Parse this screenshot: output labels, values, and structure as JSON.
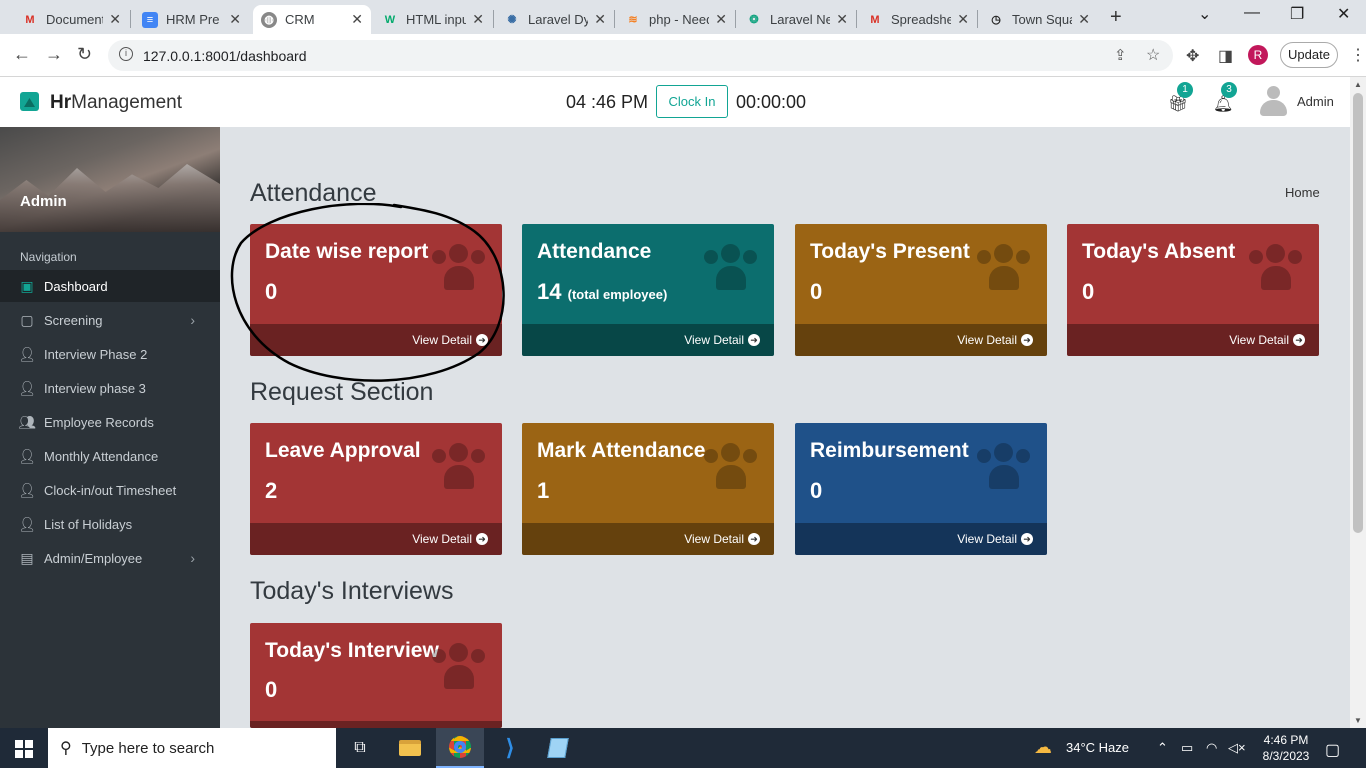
{
  "browser": {
    "tabs": [
      {
        "title": "Documents",
        "icon": "gmail-icon"
      },
      {
        "title": "HRM Pre D",
        "icon": "docs-icon"
      },
      {
        "title": "CRM",
        "icon": "globe-icon",
        "active": true
      },
      {
        "title": "HTML input",
        "icon": "w3-icon"
      },
      {
        "title": "Laravel Dy",
        "icon": "gear-icon"
      },
      {
        "title": "php - Need",
        "icon": "stackoverflow-icon"
      },
      {
        "title": "Laravel Ne",
        "icon": "openai-icon"
      },
      {
        "title": "Spreadshe",
        "icon": "gmail-icon"
      },
      {
        "title": "Town Squa",
        "icon": "clock-icon"
      }
    ],
    "url": "127.0.0.1:8001/dashboard",
    "profile_initial": "R",
    "update_label": "Update"
  },
  "header": {
    "brand_bold": "Hr",
    "brand_rest": "Management",
    "time": "04 :46 PM",
    "clock_in_label": "Clock In",
    "timer": "00:00:00",
    "gift_badge": "1",
    "bell_badge": "3",
    "user": "Admin"
  },
  "sidebar": {
    "user": "Admin",
    "heading": "Navigation",
    "items": [
      {
        "label": "Dashboard",
        "icon": "dashboard-icon",
        "active": true
      },
      {
        "label": "Screening",
        "icon": "screen-icon",
        "submenu": true
      },
      {
        "label": "Interview Phase 2",
        "icon": "user-edit-icon"
      },
      {
        "label": "Interview phase 3",
        "icon": "user-edit-icon"
      },
      {
        "label": "Employee Records",
        "icon": "users-icon"
      },
      {
        "label": "Monthly Attendance",
        "icon": "user-check-icon"
      },
      {
        "label": "Clock-in/out Timesheet",
        "icon": "user-clock-icon"
      },
      {
        "label": "List of Holidays",
        "icon": "user-edit-icon"
      },
      {
        "label": "Admin/Employee",
        "icon": "id-card-icon",
        "submenu": true
      }
    ]
  },
  "content": {
    "breadcrumb": "Home",
    "sections": [
      {
        "title": "Attendance"
      },
      {
        "title": "Request Section"
      },
      {
        "title": "Today's Interviews"
      }
    ],
    "view_detail": "View Detail",
    "cards": [
      {
        "title": "Date wise report",
        "value": "0",
        "color": "#a33535"
      },
      {
        "title": "Attendance",
        "value": "14",
        "suffix": "(total employee)",
        "color": "#0c6e6e"
      },
      {
        "title": "Today's Present",
        "value": "0",
        "color": "#9b6414"
      },
      {
        "title": "Today's Absent",
        "value": "0",
        "color": "#a33535"
      },
      {
        "title": "Leave Approval",
        "value": "2",
        "color": "#a33535"
      },
      {
        "title": "Mark Attendance",
        "value": "1",
        "color": "#9b6414"
      },
      {
        "title": "Reimbursement",
        "value": "0",
        "color": "#1f5189"
      },
      {
        "title": "Today's Interview",
        "value": "0",
        "color": "#a33535"
      }
    ]
  },
  "taskbar": {
    "search_placeholder": "Type here to search",
    "weather": "34°C  Haze",
    "time": "4:46 PM",
    "date": "8/3/2023"
  }
}
